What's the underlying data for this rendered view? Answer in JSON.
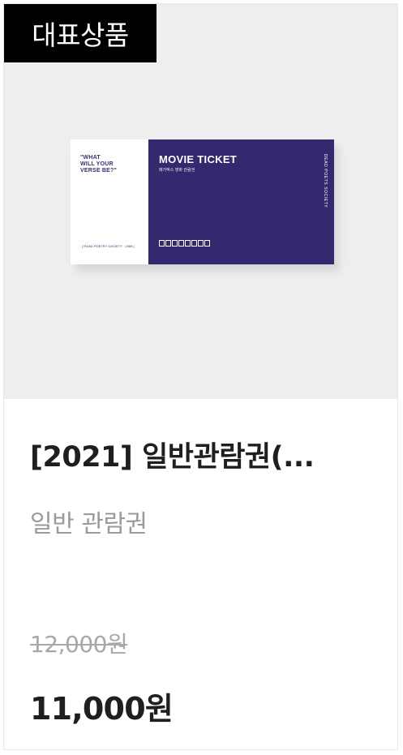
{
  "badge": "대표상품",
  "ticket": {
    "stub_quote": "\"WHAT\nWILL YOUR\nVERSE BE?\"",
    "stub_footer": "[ ROAD POETRY SOCIETY · 1989 ]",
    "movie_title": "MOVIE TICKET",
    "movie_subtitle": "메가박스 영화 관람권",
    "vertical_text": "DEAD POETS SOCIETY",
    "logo_letters": 8
  },
  "product": {
    "title": "[2021] 일반관람권(...",
    "subtitle": "일반 관람권",
    "original_price": "12,000원",
    "price": "11,000원"
  }
}
